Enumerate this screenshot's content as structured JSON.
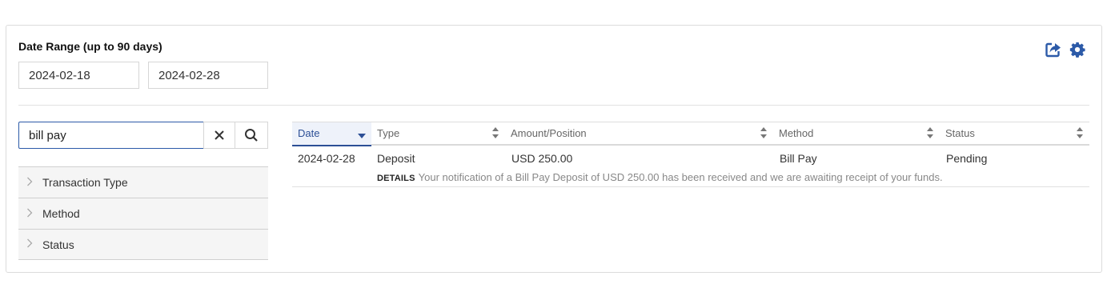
{
  "date_range": {
    "label": "Date Range (up to 90 days)",
    "from": "2024-02-18",
    "to": "2024-02-28"
  },
  "toolbar": {
    "export_icon": "share-export-icon",
    "settings_icon": "gear-icon",
    "accent_color": "#2c5aa8"
  },
  "search": {
    "value": "bill pay",
    "clear_icon": "close-icon",
    "search_icon": "search-icon"
  },
  "filters": [
    {
      "label": "Transaction Type"
    },
    {
      "label": "Method"
    },
    {
      "label": "Status"
    }
  ],
  "table": {
    "columns": [
      "Date",
      "Type",
      "Amount/Position",
      "Method",
      "Status"
    ],
    "rows": [
      {
        "date": "2024-02-28",
        "type": "Deposit",
        "amount": "USD 250.00",
        "method": "Bill Pay",
        "status": "Pending",
        "details_label": "DETAILS",
        "details_text": "Your notification of a Bill Pay Deposit of USD 250.00 has been received and we are awaiting receipt of your funds."
      }
    ]
  }
}
